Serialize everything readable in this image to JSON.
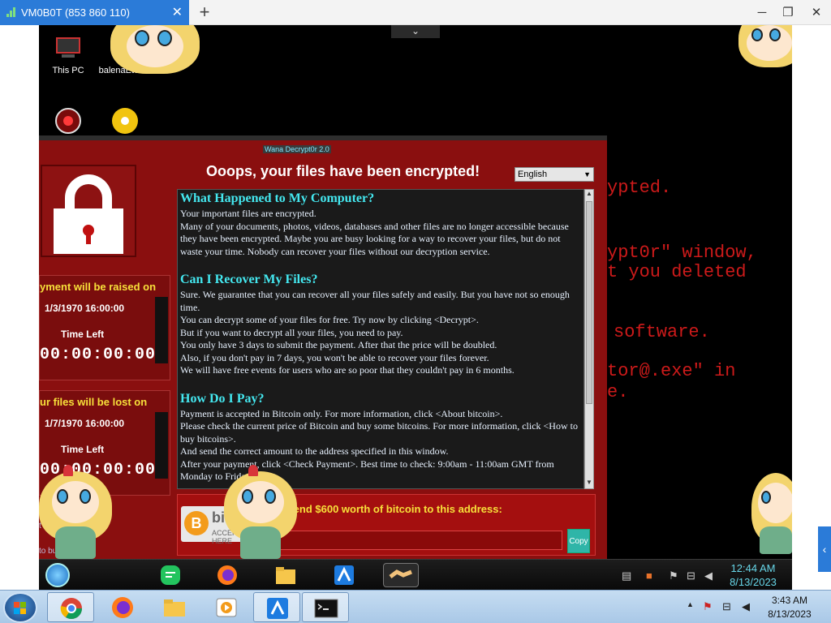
{
  "window": {
    "title": "VM0B0T (853 860 110)",
    "tab_close": "✕",
    "new_tab": "+",
    "minimize": "─",
    "restore": "❐",
    "close": "✕",
    "toolbar_toggle": "⌄",
    "side_panel_toggle": "‹"
  },
  "desktop": {
    "icons": [
      {
        "label": "This PC"
      },
      {
        "label": "balenaEtcher"
      }
    ],
    "wallpaper_text": [
      "ypted.",
      "ypt0r\" window,",
      "t you deleted",
      "software.",
      "tor@.exe\" in",
      "e."
    ],
    "wallpaper_color": "#cc1a1a"
  },
  "ransom": {
    "title": "Wana Decrypt0r 2.0",
    "headline": "Ooops, your files have been encrypted!",
    "language": "English",
    "panel_raise": {
      "title": "yment will be raised on",
      "date": "1/3/1970 16:00:00",
      "time_left_label": "Time Left",
      "timer": "00:00:00:00"
    },
    "panel_lost": {
      "title": "ur files will be lost on",
      "date": "1/7/1970 16:00:00",
      "time_left_label": "Time Left",
      "timer": "00:00:00:00"
    },
    "sections": [
      {
        "heading": "What Happened to My Computer?",
        "paragraphs": [
          "Your important files are encrypted.",
          "Many of your documents, photos, videos, databases and other files are no longer accessible because they have been encrypted. Maybe you are busy looking for a way to recover your files, but do not waste your time. Nobody can recover your files without our decryption service."
        ]
      },
      {
        "heading": "Can I Recover My Files?",
        "paragraphs": [
          "Sure. We guarantee that you can recover all your files safely and easily. But you have not so enough time.",
          "You can decrypt some of your files for free. Try now by clicking <Decrypt>.",
          "But if you want to decrypt all your files, you need to pay.",
          "You only have 3 days to submit the payment. After that the price will be doubled.",
          "Also, if you don't pay in 7 days, you won't be able to recover your files forever.",
          "We will have free events for users who are so poor that they couldn't pay in 6 months."
        ]
      },
      {
        "heading": "How Do I Pay?",
        "paragraphs": [
          "Payment is accepted in Bitcoin only. For more information, click <About bitcoin>.",
          "Please check the current price of Bitcoin and buy some bitcoins. For more information, click <How to buy bitcoins>.",
          "And send the correct amount to the address specified in this window.",
          "After your payment, click <Check Payment>. Best time to check: 9:00am - 11:00am GMT from Monday to Friday."
        ]
      }
    ],
    "pay_text": "Send $600 worth of bitcoin to this address:",
    "bitcoin_logo_text": "bitcoin",
    "bitcoin_accepted": "ACCEPTED HERE",
    "copy_label": "Copy",
    "left_links": [
      "t bit",
      "to bu"
    ]
  },
  "remote_taskbar": {
    "time": "12:44 AM",
    "date": "8/13/2023",
    "apps": [
      "chat-app",
      "firefox",
      "file-explorer",
      "anydesk",
      "handshake"
    ]
  },
  "taskbar": {
    "time": "3:43 AM",
    "date": "8/13/2023",
    "apps": [
      "chrome",
      "firefox",
      "file-explorer",
      "media-player",
      "anydesk",
      "cmd"
    ],
    "tray_arrow": "▲"
  },
  "colors": {
    "accent_blue": "#2b7bd8",
    "ransom_red": "#8a0f0f",
    "heading_cyan": "#44e8f0",
    "warning_yellow": "#f7e03a"
  }
}
